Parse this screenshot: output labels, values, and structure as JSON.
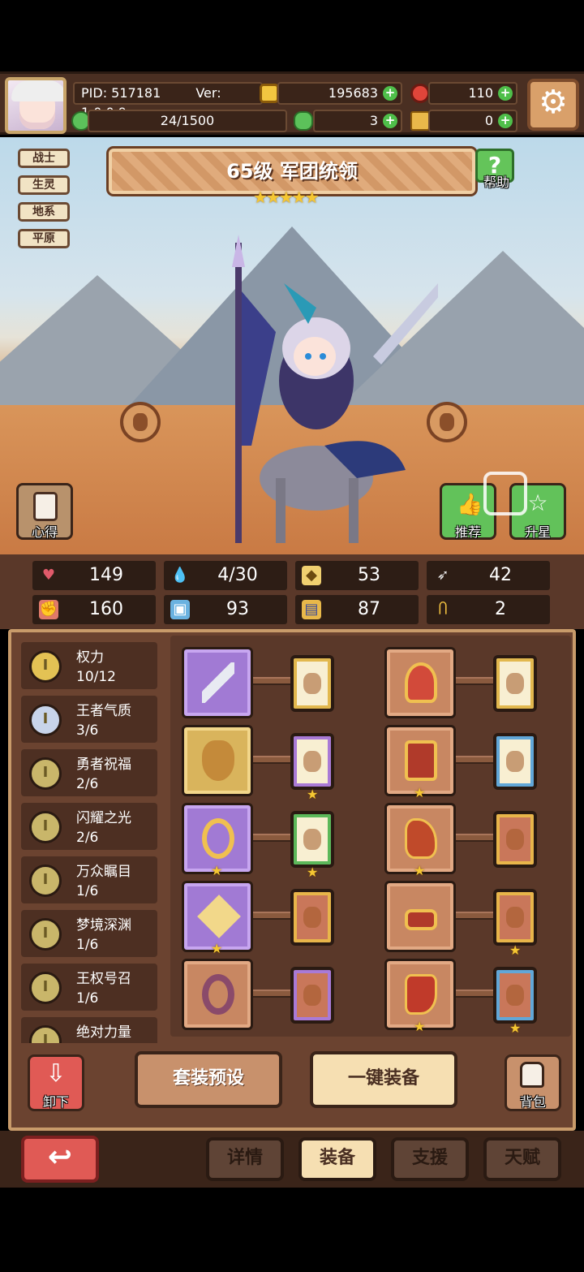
{
  "header": {
    "pid_text": "PID: 517181",
    "version_text": "Ver: 1.0.0.9",
    "gold": "195683",
    "gems": "110",
    "experience": "24/1500",
    "clover": "3",
    "key": "0"
  },
  "hero": {
    "tags": [
      "战士",
      "生灵",
      "地系",
      "平原"
    ],
    "title": "65级  军团统领",
    "stars": "★★★★★",
    "help_label": "帮助",
    "insight_label": "心得",
    "recommend_label": "推荐",
    "upgrade_star_label": "升星"
  },
  "stats": {
    "hp": "149",
    "mana": "4/30",
    "armor": "53",
    "speed": "42",
    "attack": "160",
    "magic": "93",
    "resist": "87",
    "luck": "2"
  },
  "sets": [
    {
      "name": "权力",
      "progress": "10/12"
    },
    {
      "name": "王者气质",
      "progress": "3/6"
    },
    {
      "name": "勇者祝福",
      "progress": "2/6"
    },
    {
      "name": "闪耀之光",
      "progress": "2/6"
    },
    {
      "name": "万众瞩目",
      "progress": "1/6"
    },
    {
      "name": "梦境深渊",
      "progress": "1/6"
    },
    {
      "name": "王权号召",
      "progress": "1/6"
    },
    {
      "name": "绝对力量",
      "progress": ""
    }
  ],
  "actions": {
    "unequip_label": "卸下",
    "preset_label": "套装预设",
    "auto_equip_label": "一键装备",
    "bag_label": "背包"
  },
  "tabs": {
    "back_icon": "undo-arrow-icon",
    "details": "详情",
    "equipment": "装备",
    "support": "支援",
    "talent": "天赋"
  },
  "colors": {
    "accent_gold": "#f5c733",
    "plus_green": "#4fbf4a",
    "back_red": "#e05a55",
    "panel_brown": "#6b4330"
  }
}
